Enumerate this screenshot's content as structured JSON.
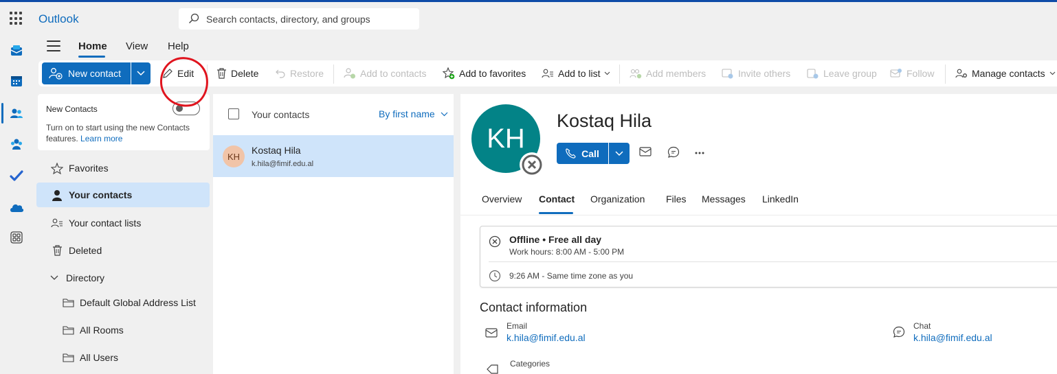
{
  "app": {
    "name": "Outlook",
    "search_placeholder": "Search contacts, directory, and groups"
  },
  "tabs": [
    {
      "label": "Home",
      "selected": true
    },
    {
      "label": "View"
    },
    {
      "label": "Help"
    }
  ],
  "ribbon": {
    "new_contact": "New contact",
    "edit": "Edit",
    "delete": "Delete",
    "restore": "Restore",
    "add_to_contacts": "Add to contacts",
    "add_to_favorites": "Add to favorites",
    "add_to_list": "Add to list",
    "add_members": "Add members",
    "invite_others": "Invite others",
    "leave_group": "Leave group",
    "follow": "Follow",
    "manage_contacts": "Manage contacts"
  },
  "new_contacts": {
    "title": "New Contacts",
    "description": "Turn on to start using the new Contacts features.",
    "learn_more": "Learn more",
    "toggle_on": false
  },
  "nav": {
    "favorites": "Favorites",
    "your_contacts": "Your contacts",
    "contact_lists": "Your contact lists",
    "deleted": "Deleted",
    "directory": "Directory",
    "gal": "Default Global Address List",
    "rooms": "All Rooms",
    "users": "All Users"
  },
  "list": {
    "header": "Your contacts",
    "sort": "By first name",
    "contact": {
      "initials": "KH",
      "name": "Kostaq Hila",
      "email": "k.hila@fimif.edu.al"
    }
  },
  "detail": {
    "initials": "KH",
    "name": "Kostaq Hila",
    "call": "Call",
    "tabs": [
      "Overview",
      "Contact",
      "Organization",
      "Files",
      "Messages",
      "LinkedIn"
    ],
    "selected_tab": "Contact",
    "status": "Offline • Free all day",
    "work_hours": "Work hours: 8:00 AM - 5:00 PM",
    "local_time": "9:26 AM - Same time zone as you",
    "contact_info_title": "Contact information",
    "email_label": "Email",
    "email": "k.hila@fimif.edu.al",
    "chat_label": "Chat",
    "chat": "k.hila@fimif.edu.al",
    "categories_label": "Categories"
  },
  "colors": {
    "accent": "#0f6cbd",
    "selected": "#cfe4fa",
    "avatar": "#038387",
    "annotation": "#e0141e"
  }
}
